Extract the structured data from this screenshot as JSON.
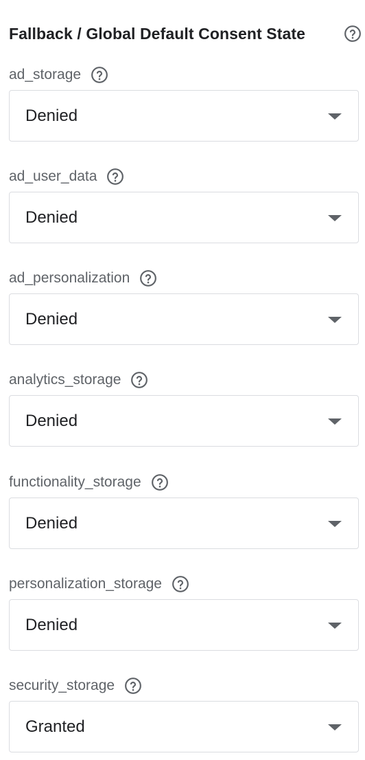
{
  "header": {
    "title": "Fallback / Global Default Consent State",
    "help_icon": "help-circle-icon"
  },
  "fields": [
    {
      "label": "ad_storage",
      "value": "Denied"
    },
    {
      "label": "ad_user_data",
      "value": "Denied"
    },
    {
      "label": "ad_personalization",
      "value": "Denied"
    },
    {
      "label": "analytics_storage",
      "value": "Denied"
    },
    {
      "label": "functionality_storage",
      "value": "Denied"
    },
    {
      "label": "personalization_storage",
      "value": "Denied"
    },
    {
      "label": "security_storage",
      "value": "Granted"
    }
  ],
  "colors": {
    "label": "#5f6368",
    "text": "#202124",
    "border": "#dadce0"
  }
}
